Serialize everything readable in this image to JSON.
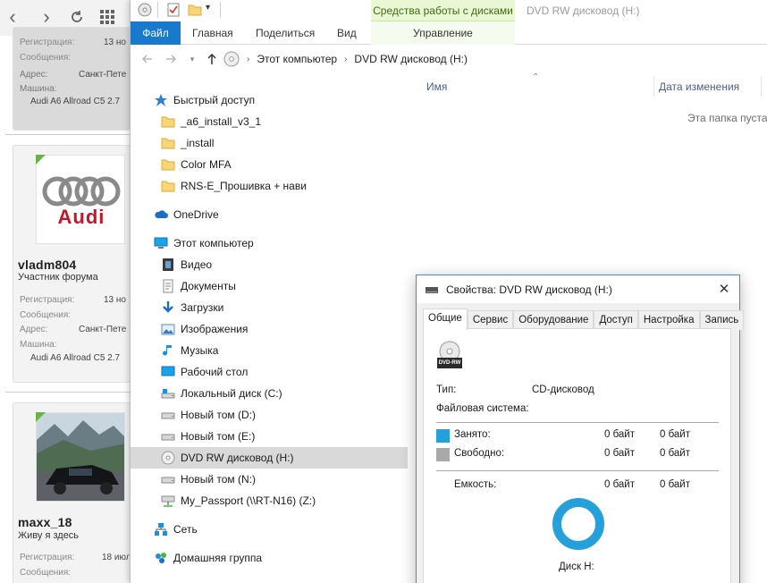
{
  "colors": {
    "accent": "#1979ca",
    "used": "#26a0da",
    "free": "#a9a9a9",
    "ring": "#26a0da",
    "ribbon_context": "#e9f7d4"
  },
  "forum": {
    "users": [
      {
        "registration_label": "Регистрация:",
        "registration_value": "13 но",
        "messages_label": "Сообщения:",
        "address_label": "Адрес:",
        "address_value": "Санкт-Пете",
        "car_label": "Машина:",
        "car_value": "Audi A6 Allroad C5 2.7"
      },
      {
        "name": "vladm804",
        "title": "Участник форума",
        "avatar_icon": "audi-logo",
        "avatar_text": "Audi",
        "registration_label": "Регистрация:",
        "registration_value": "13 но",
        "messages_label": "Сообщения:",
        "address_label": "Адрес:",
        "address_value": "Санкт-Пете",
        "car_label": "Машина:",
        "car_value": "Audi A6 Allroad C5 2.7"
      },
      {
        "name": "maxx_18",
        "title": "Живу я здесь",
        "avatar_icon": "car-photo",
        "registration_label": "Регистрация:",
        "registration_value": "18 июл",
        "messages_label": "Сообщения:"
      }
    ]
  },
  "explorer": {
    "window_title": "DVD RW дисковод (H:)",
    "context_tab_group": "Средства работы с дисками",
    "tabs": {
      "file": "Файл",
      "home": "Главная",
      "share": "Поделиться",
      "view": "Вид",
      "manage": "Управление"
    },
    "breadcrumb": [
      "Этот компьютер",
      "DVD RW дисковод (H:)"
    ],
    "nav": [
      {
        "label": "Быстрый доступ",
        "icon": "star-icon"
      },
      {
        "label": "_a6_install_v3_1",
        "icon": "folder-icon"
      },
      {
        "label": "_install",
        "icon": "folder-icon"
      },
      {
        "label": "Color MFA",
        "icon": "folder-icon"
      },
      {
        "label": "RNS-E_Прошивка + нави",
        "icon": "folder-icon"
      },
      {
        "label": "OneDrive",
        "icon": "cloud-icon"
      },
      {
        "label": "Этот компьютер",
        "icon": "computer-icon"
      },
      {
        "label": "Видео",
        "icon": "video-icon"
      },
      {
        "label": "Документы",
        "icon": "documents-icon"
      },
      {
        "label": "Загрузки",
        "icon": "download-icon"
      },
      {
        "label": "Изображения",
        "icon": "pictures-icon"
      },
      {
        "label": "Музыка",
        "icon": "music-icon"
      },
      {
        "label": "Рабочий стол",
        "icon": "desktop-icon"
      },
      {
        "label": "Локальный диск (C:)",
        "icon": "system-drive-icon"
      },
      {
        "label": "Новый том (D:)",
        "icon": "drive-icon"
      },
      {
        "label": "Новый том (E:)",
        "icon": "drive-icon"
      },
      {
        "label": "DVD RW дисковод (H:)",
        "icon": "dvd-icon",
        "selected": true
      },
      {
        "label": "Новый том (N:)",
        "icon": "drive-icon"
      },
      {
        "label": "My_Passport (\\\\RT-N16) (Z:)",
        "icon": "network-drive-icon"
      },
      {
        "label": "Сеть",
        "icon": "network-icon"
      },
      {
        "label": "Домашняя группа",
        "icon": "homegroup-icon"
      }
    ],
    "columns": {
      "name": "Имя",
      "date": "Дата изменения"
    },
    "empty_message": "Эта папка пуста."
  },
  "dialog": {
    "title": "Свойства: DVD RW дисковод (H:)",
    "tabs": [
      "Общие",
      "Сервис",
      "Оборудование",
      "Доступ",
      "Настройка",
      "Запись"
    ],
    "active_tab": 0,
    "drive_icon_text": "DVD-RW",
    "type_label": "Тип:",
    "type_value": "CD-дисковод",
    "fs_label": "Файловая система:",
    "used_label": "Занято:",
    "used_bytes": "0 байт",
    "used_size": "0 байт",
    "free_label": "Свободно:",
    "free_bytes": "0 байт",
    "free_size": "0 байт",
    "capacity_label": "Емкость:",
    "capacity_bytes": "0 байт",
    "capacity_size": "0 байт",
    "disk_label": "Диск H:",
    "used_fraction": 0
  }
}
